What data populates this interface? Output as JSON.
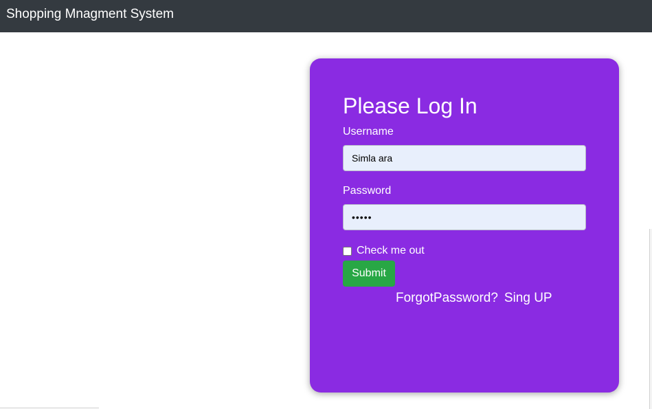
{
  "navbar": {
    "brand": "Shopping Mnagment System"
  },
  "login": {
    "title": "Please Log In",
    "username_label": "Username",
    "username_value": "Simla ara",
    "password_label": "Password",
    "password_value": "•••••",
    "checkbox_label": "Check me out",
    "checkbox_checked": false,
    "submit_label": "Submit",
    "forgot_link": "ForgotPassword?",
    "signup_link": "Sing UP"
  },
  "colors": {
    "navbar_bg": "#343a40",
    "card_bg": "#8a2be2",
    "submit_bg": "#28a745",
    "input_bg": "#e8effc"
  }
}
